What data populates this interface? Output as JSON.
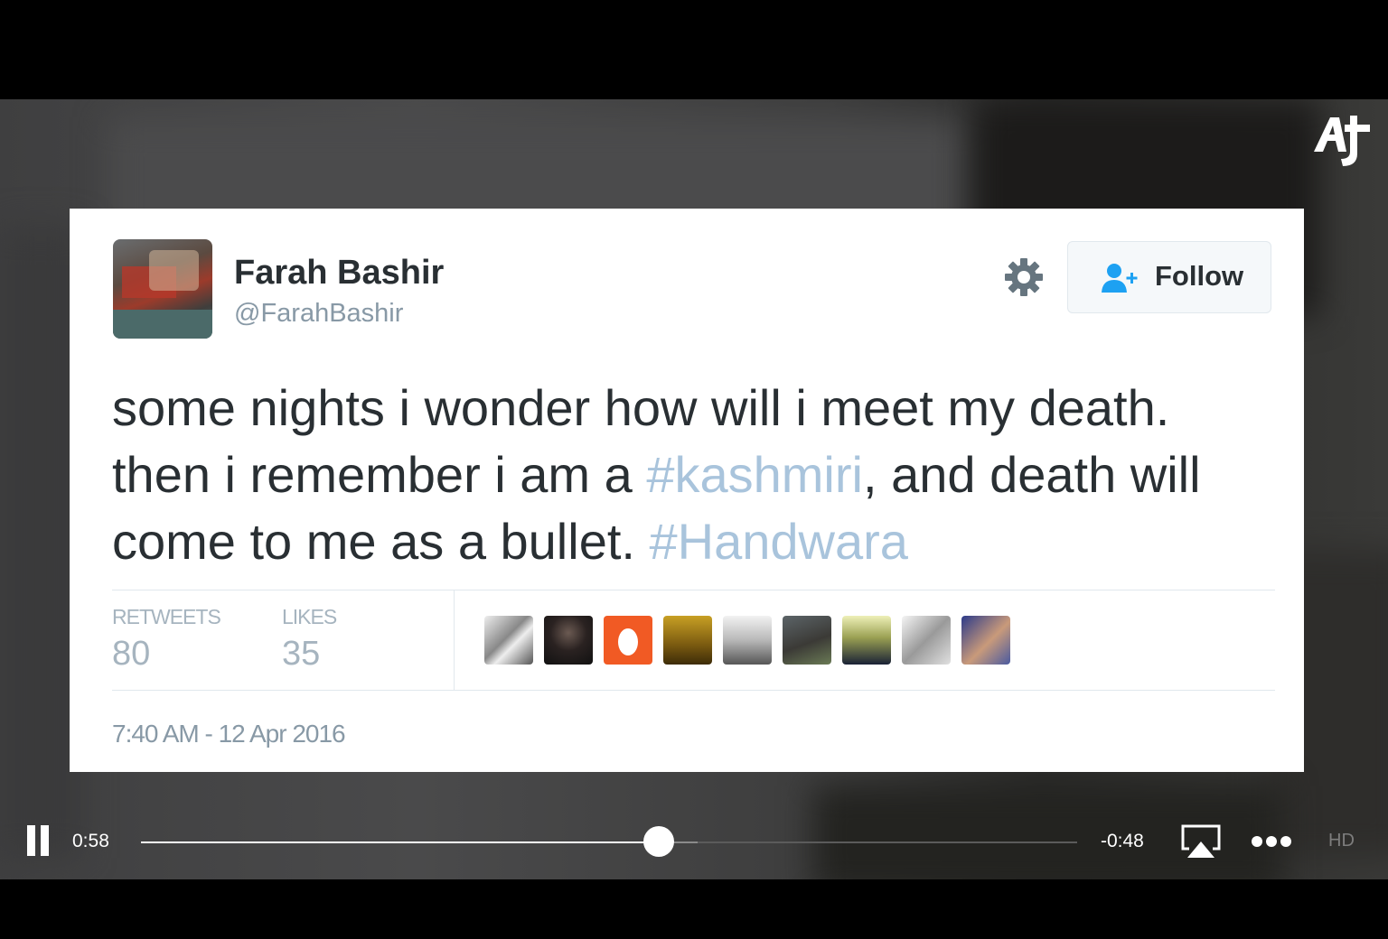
{
  "brand": {
    "logo": "aj-plus-logo",
    "accent": "#ffffff"
  },
  "tweet": {
    "display_name": "Farah Bashir",
    "handle": "@FarahBashir",
    "follow_label": "Follow",
    "text_parts": [
      {
        "text": "some nights i wonder how will i meet my death. then i remember i am a ",
        "hashtag": false
      },
      {
        "text": "#kashmiri",
        "hashtag": true
      },
      {
        "text": ", and death will come to me as a bullet. ",
        "hashtag": false
      },
      {
        "text": "#Handwara",
        "hashtag": true
      }
    ],
    "retweets_label": "RETWEETS",
    "retweets_count": "80",
    "likes_label": "LIKES",
    "likes_count": "35",
    "liker_avatars": [
      "liker-avatar-1",
      "liker-avatar-2",
      "liker-avatar-3",
      "liker-avatar-4",
      "liker-avatar-5",
      "liker-avatar-6",
      "liker-avatar-7",
      "liker-avatar-8",
      "liker-avatar-9"
    ],
    "timestamp": "7:40 AM - 12 Apr 2016",
    "colors": {
      "text": "#292f33",
      "hashtag": "#a9c4dc",
      "muted": "#8899a6",
      "follow_icon": "#1da1f2"
    }
  },
  "player": {
    "elapsed": "0:58",
    "remaining": "-0:48",
    "progress": 0.553,
    "buffered": 0.595,
    "quality": "HD",
    "icons": [
      "pause-icon",
      "airplay-icon",
      "more-icon"
    ]
  }
}
